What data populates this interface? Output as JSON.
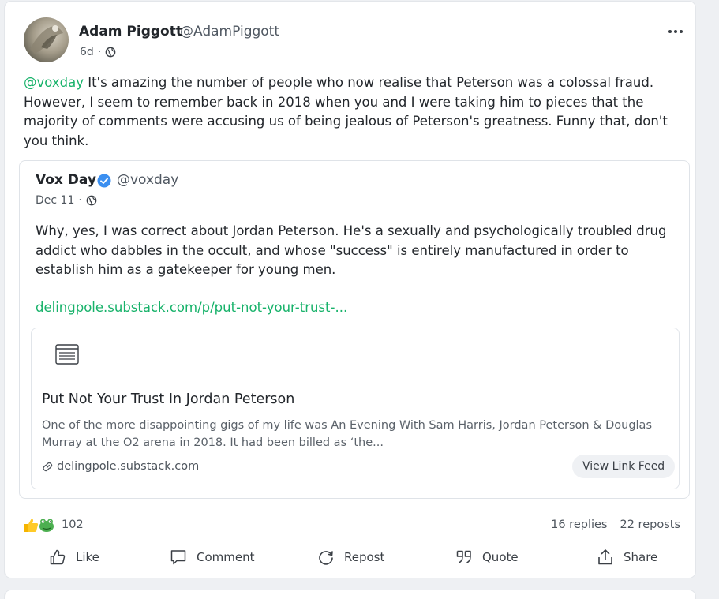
{
  "post": {
    "author_name": "Adam Piggott",
    "author_handle": "@AdamPiggott",
    "time": "6d",
    "separator": "·",
    "mention": "@voxday",
    "text": " It's amazing the number of people who now realise that Peterson was a colossal fraud. However, I seem to remember back in 2018 when you and I were taking him to pieces that the majority of comments were accusing us of being jealous of Peterson's greatness. Funny that, don't you think."
  },
  "quoted": {
    "author_name": "Vox Day",
    "author_handle": "@voxday",
    "time": "Dec 11",
    "separator": "·",
    "text": "Why, yes, I was correct about Jordan Peterson. He's a sexually and psychologically troubled drug addict who dabbles in the occult, and whose \"success\" is entirely manufactured in order to establish him as a gatekeeper for young men.",
    "link": "delingpole.substack.com/p/put-not-your-trust-...",
    "preview": {
      "title": "Put Not Your Trust In Jordan Peterson",
      "description": "One of the more disappointing gigs of my life was An Evening With Sam Harris, Jordan Peterson & Douglas Murray at the O2 arena in 2018. It had been billed as ‘the...",
      "domain": "delingpole.substack.com",
      "button": "View Link Feed"
    }
  },
  "engagement": {
    "reaction_count": "102",
    "replies": "16 replies",
    "reposts": "22 reposts"
  },
  "actions": {
    "like": "Like",
    "comment": "Comment",
    "repost": "Repost",
    "quote": "Quote",
    "share": "Share"
  },
  "colors": {
    "accent": "#17b26a",
    "verified": "#3b8ff0"
  }
}
